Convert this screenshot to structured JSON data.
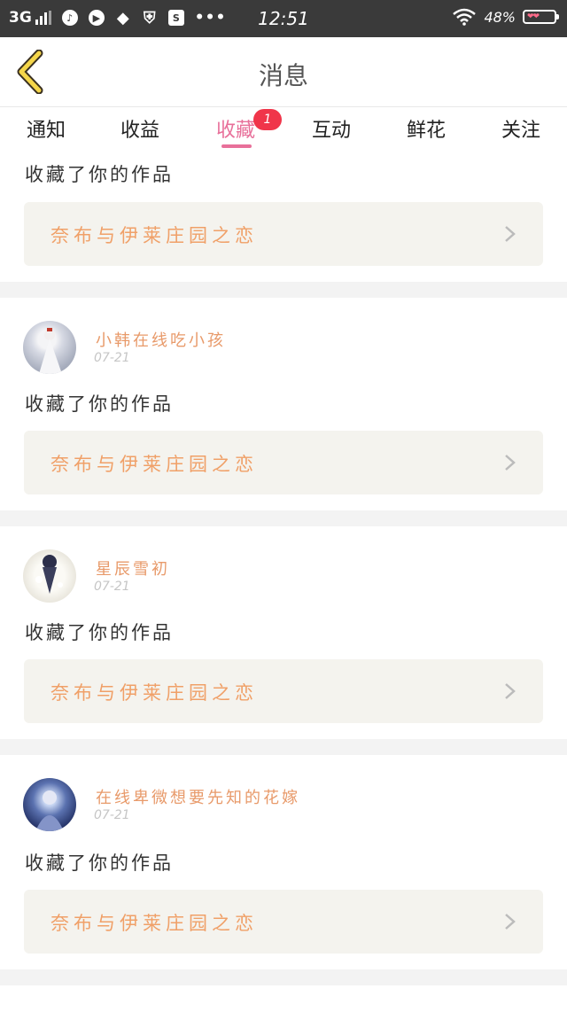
{
  "status_bar": {
    "network": "3G",
    "time": "12:51",
    "battery": "48%",
    "icons": [
      "signal-icon",
      "music-icon",
      "play-icon",
      "qq-icon",
      "shield-icon",
      "s-icon",
      "more-icon",
      "wifi-icon",
      "battery-icon"
    ]
  },
  "header": {
    "title": "消息",
    "back_icon": "chevron-left-icon"
  },
  "tabs": [
    {
      "label": "通知"
    },
    {
      "label": "收益"
    },
    {
      "label": "收藏",
      "active": true,
      "badge": "1"
    },
    {
      "label": "互动"
    },
    {
      "label": "鲜花"
    },
    {
      "label": "关注"
    }
  ],
  "colors": {
    "accent": "#e8709a",
    "badge": "#f0354a",
    "work_title": "#f0a068",
    "username": "#e89a6a"
  },
  "feed": [
    {
      "action": "收藏了你的作品",
      "work_title": "奈布与伊莱庄园之恋"
    },
    {
      "username": "小韩在线吃小孩",
      "date": "07-21",
      "action": "收藏了你的作品",
      "work_title": "奈布与伊莱庄园之恋"
    },
    {
      "username": "星辰雪初",
      "date": "07-21",
      "action": "收藏了你的作品",
      "work_title": "奈布与伊莱庄园之恋"
    },
    {
      "username": "在线卑微想要先知的花嫁",
      "date": "07-21",
      "action": "收藏了你的作品",
      "work_title": "奈布与伊莱庄园之恋"
    }
  ]
}
